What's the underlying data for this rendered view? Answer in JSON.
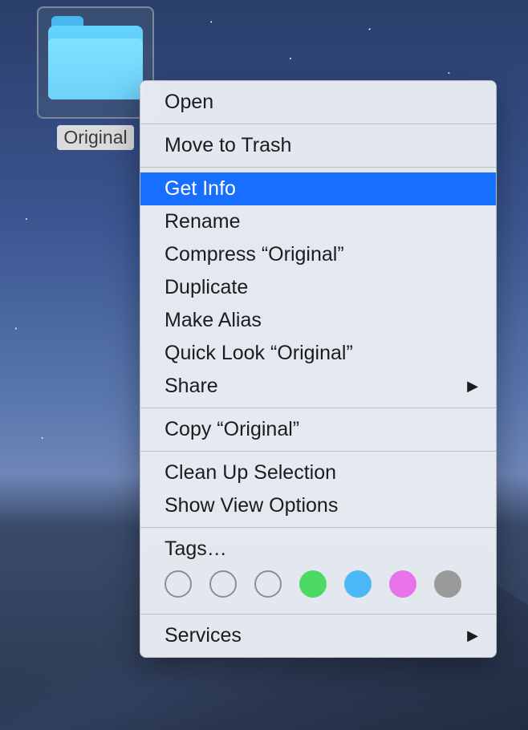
{
  "folder": {
    "name": "Original"
  },
  "menu": {
    "open": "Open",
    "move_to_trash": "Move to Trash",
    "get_info": "Get Info",
    "rename": "Rename",
    "compress": "Compress “Original”",
    "duplicate": "Duplicate",
    "make_alias": "Make Alias",
    "quick_look": "Quick Look “Original”",
    "share": "Share",
    "copy": "Copy “Original”",
    "clean_up_selection": "Clean Up Selection",
    "show_view_options": "Show View Options",
    "tags": "Tags…",
    "services": "Services"
  },
  "tag_colors": {
    "empty1": "transparent",
    "empty2": "transparent",
    "empty3": "transparent",
    "green": "#4cd964",
    "blue": "#4bb7f5",
    "pink": "#e872e8",
    "gray": "#9a9a9a"
  }
}
